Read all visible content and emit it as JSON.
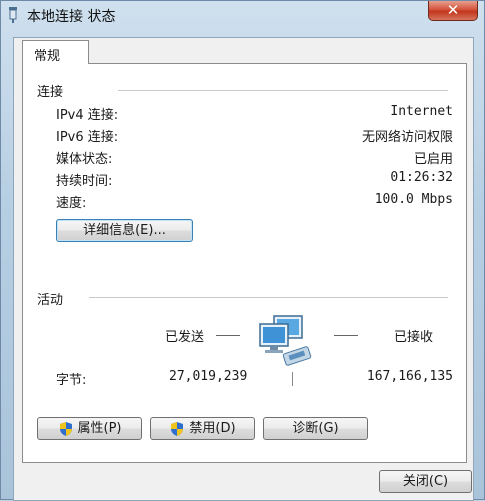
{
  "window": {
    "title": "本地连接 状态",
    "close_glyph": "✕"
  },
  "tabs": [
    {
      "label": "常规"
    }
  ],
  "connection": {
    "group_label": "连接",
    "rows": [
      {
        "label": "IPv4 连接:",
        "value": "Internet"
      },
      {
        "label": "IPv6 连接:",
        "value": "无网络访问权限"
      },
      {
        "label": "媒体状态:",
        "value": "已启用"
      },
      {
        "label": "持续时间:",
        "value": "01:26:32"
      },
      {
        "label": "速度:",
        "value": "100.0 Mbps"
      }
    ],
    "details_button": "详细信息(E)..."
  },
  "activity": {
    "group_label": "活动",
    "sent_label": "已发送",
    "received_label": "已接收",
    "bytes_label": "字节:",
    "bytes_sent": "27,019,239",
    "bytes_received": "167,166,135"
  },
  "buttons": {
    "properties": "属性(P)",
    "disable": "禁用(D)",
    "diagnose": "诊断(G)",
    "close": "关闭(C)"
  },
  "colors": {
    "shield_blue": "#2f6fd0",
    "shield_yellow": "#f2c31c",
    "close_red": "#c8442b"
  }
}
